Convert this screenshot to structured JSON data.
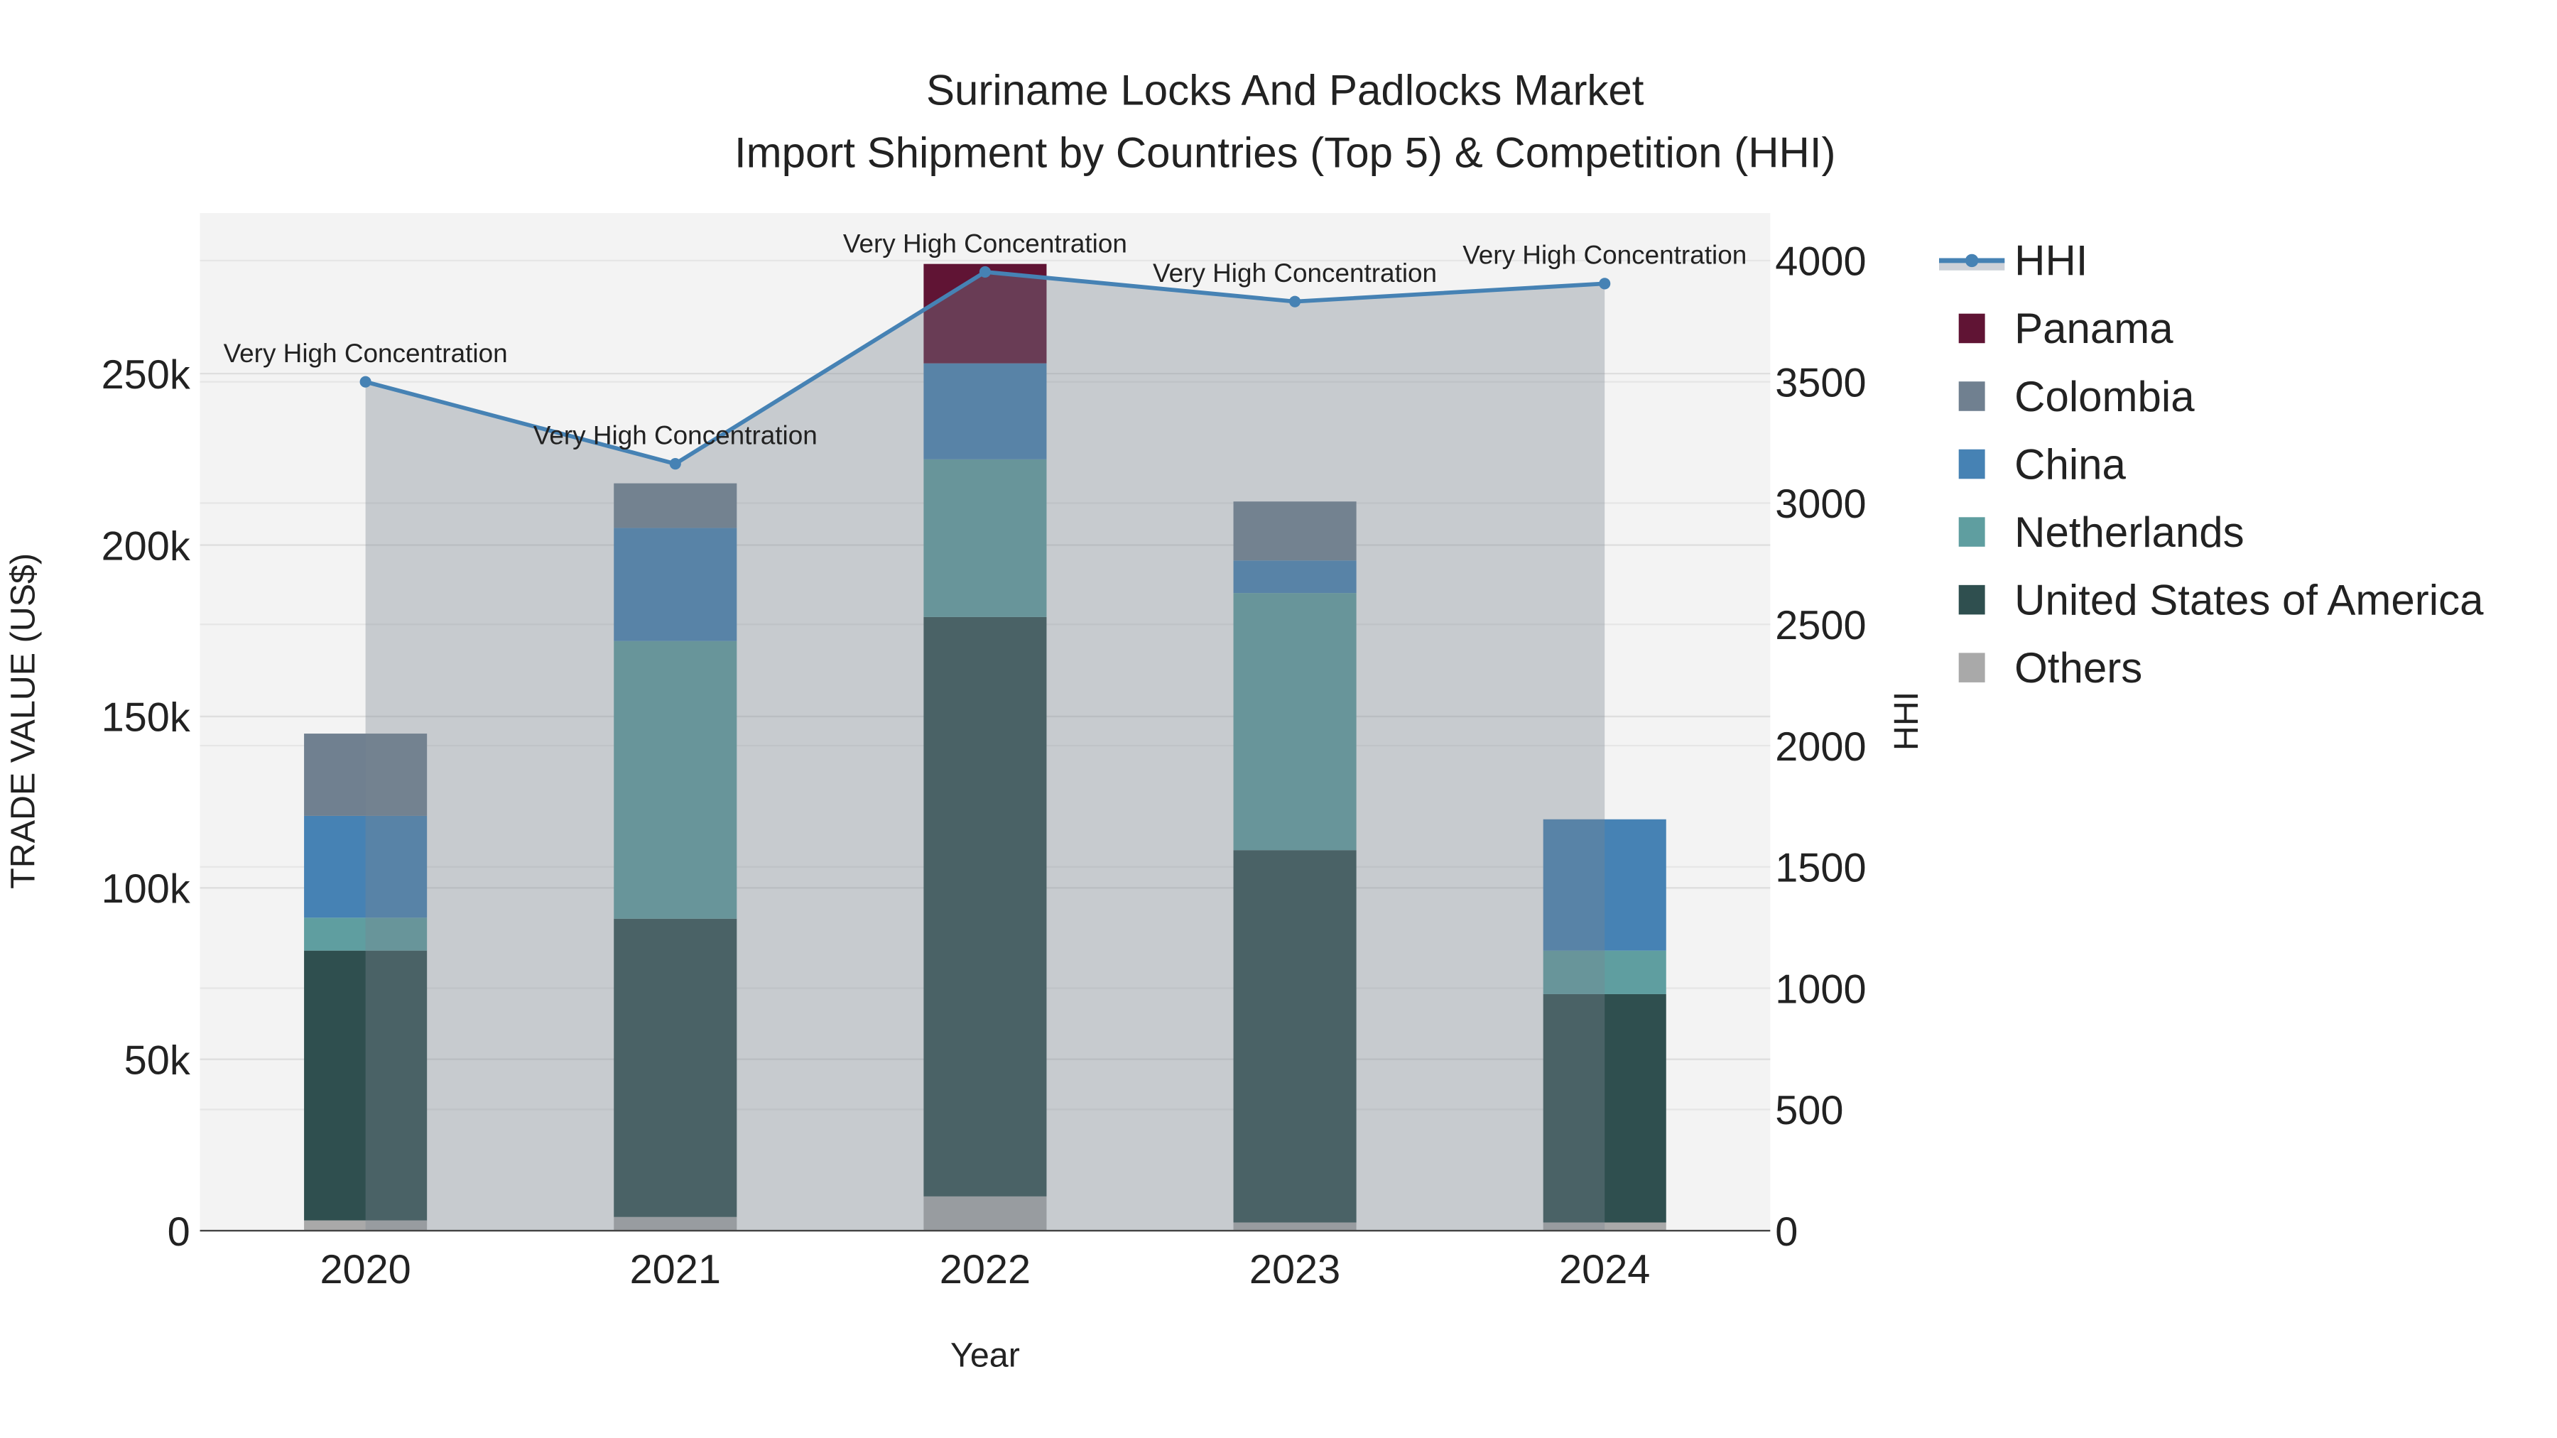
{
  "chart_data": {
    "type": "bar",
    "title": "Suriname Locks And Padlocks Market",
    "subtitle": "Import Shipment by Countries (Top 5) & Competition (HHI)",
    "xlabel": "Year",
    "ylabel": "TRADE VALUE (US$)",
    "y2label": "HHI",
    "categories": [
      "2020",
      "2021",
      "2022",
      "2023",
      "2024"
    ],
    "ylim": [
      0,
      297000
    ],
    "y_ticks": [
      0,
      50000,
      100000,
      150000,
      200000,
      250000
    ],
    "y_tick_labels": [
      "0",
      "50k",
      "100k",
      "150k",
      "200k",
      "250k"
    ],
    "y2lim": [
      0,
      4200
    ],
    "y2_ticks": [
      0,
      500,
      1000,
      1500,
      2000,
      2500,
      3000,
      3500,
      4000
    ],
    "y2_tick_labels": [
      "0",
      "500",
      "1000",
      "1500",
      "2000",
      "2500",
      "3000",
      "3500",
      "4000"
    ],
    "grid": true,
    "legend_placement": "right",
    "series": [
      {
        "name": "Others",
        "color": "#a9a9a9",
        "values": [
          3000,
          4000,
          10000,
          2400,
          2400
        ]
      },
      {
        "name": "United States of America",
        "color": "#2f4f4f",
        "values": [
          78700,
          87000,
          169000,
          108600,
          66600
        ]
      },
      {
        "name": "Netherlands",
        "color": "#5f9ea0",
        "values": [
          9600,
          81000,
          46000,
          75000,
          12700
        ]
      },
      {
        "name": "China",
        "color": "#4682b4",
        "values": [
          29700,
          33000,
          28000,
          9500,
          38300
        ]
      },
      {
        "name": "Colombia",
        "color": "#708090",
        "values": [
          24000,
          13000,
          0,
          17200,
          0
        ]
      },
      {
        "name": "Panama",
        "color": "#601434",
        "values": [
          0,
          0,
          29000,
          0,
          0
        ]
      }
    ],
    "hhi": {
      "name": "HHI",
      "color": "#4682b4",
      "values": [
        3500,
        3162,
        3953,
        3831,
        3905
      ],
      "annotations": [
        "Very High Concentration",
        "Very High Concentration",
        "Very High Concentration",
        "Very High Concentration",
        "Very High Concentration"
      ]
    },
    "legend": [
      "HHI",
      "Panama",
      "Colombia",
      "China",
      "Netherlands",
      "United States of America",
      "Others"
    ]
  }
}
